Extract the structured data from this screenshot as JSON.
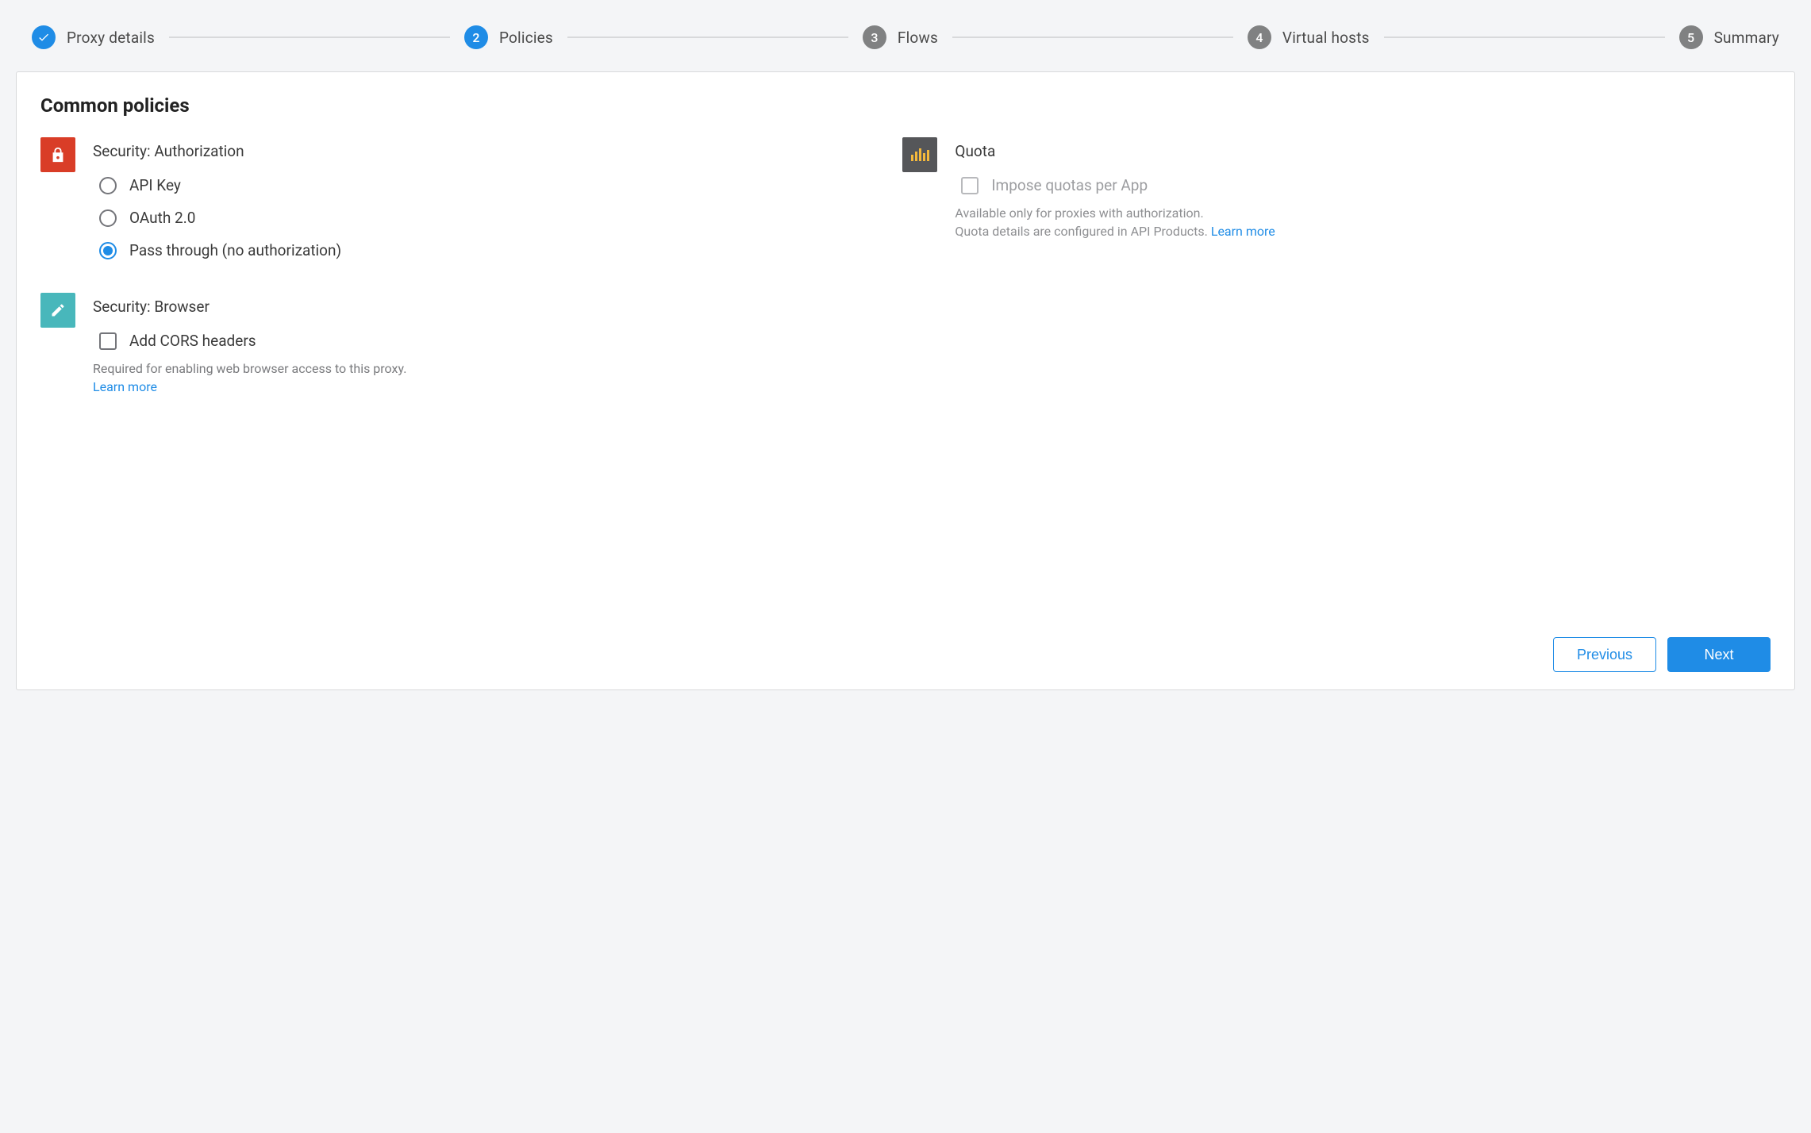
{
  "steps": [
    {
      "label": "Proxy details",
      "state": "completed",
      "indicator": "check"
    },
    {
      "label": "Policies",
      "state": "active",
      "indicator": "2"
    },
    {
      "label": "Flows",
      "state": "inactive",
      "indicator": "3"
    },
    {
      "label": "Virtual hosts",
      "state": "inactive",
      "indicator": "4"
    },
    {
      "label": "Summary",
      "state": "inactive",
      "indicator": "5"
    }
  ],
  "page_title": "Common policies",
  "sections": {
    "security_auth": {
      "title": "Security: Authorization",
      "options": [
        {
          "label": "API Key",
          "selected": false
        },
        {
          "label": "OAuth 2.0",
          "selected": false
        },
        {
          "label": "Pass through (no authorization)",
          "selected": true
        }
      ]
    },
    "security_browser": {
      "title": "Security: Browser",
      "options": [
        {
          "label": "Add CORS headers",
          "checked": false
        }
      ],
      "helper": "Required for enabling web browser access to this proxy.",
      "learn_more": "Learn more"
    },
    "quota": {
      "title": "Quota",
      "options": [
        {
          "label": "Impose quotas per App",
          "checked": false,
          "disabled": true
        }
      ],
      "helper": "Available only for proxies with authorization.\nQuota details are configured in API Products.",
      "learn_more": "Learn more"
    }
  },
  "buttons": {
    "previous": "Previous",
    "next": "Next"
  }
}
